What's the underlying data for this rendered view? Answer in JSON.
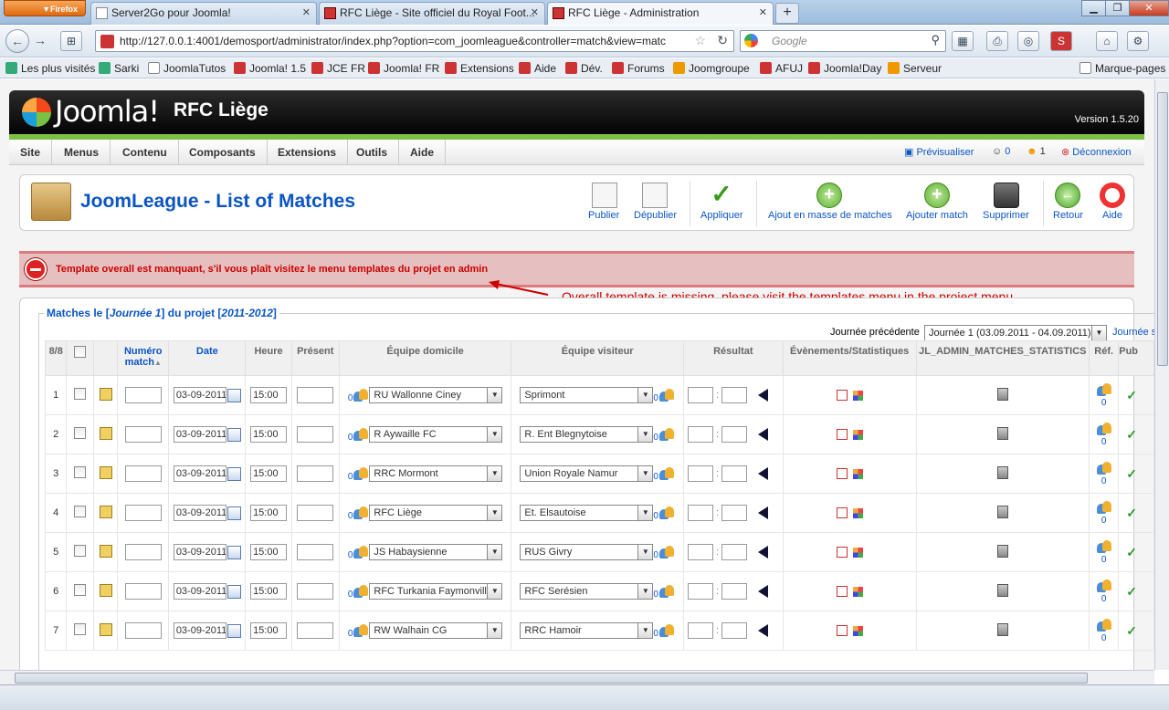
{
  "browser": {
    "app_button": "Firefox",
    "tabs": [
      {
        "title": "Server2Go pour Joomla!"
      },
      {
        "title": "RFC Liège - Site officiel du Royal Foot..."
      },
      {
        "title": "RFC Liège - Administration"
      }
    ],
    "url": "http://127.0.0.1:4001/demosport/administrator/index.php?option=com_joomleague&controller=match&view=matc",
    "search_placeholder": "Google",
    "bookmarks": [
      "Les plus visités",
      "Sarki",
      "JoomlaTutos",
      "Joomla! 1.5",
      "JCE FR",
      "Joomla! FR",
      "Extensions",
      "Aide",
      "Dév.",
      "Forums",
      "Joomgroupe",
      "AFUJ",
      "Joomla!Day",
      "Serveur"
    ],
    "bookmarks_right": "Marque-pages"
  },
  "admin": {
    "logo_text": "Joomla!",
    "site_name": "RFC Liège",
    "version": "Version 1.5.20",
    "menu": [
      "Site",
      "Menus",
      "Contenu",
      "Composants",
      "Extensions",
      "Outils",
      "Aide"
    ],
    "preview": "Prévisualiser",
    "messages_count": "0",
    "users_count": "1",
    "logout": "Déconnexion",
    "page_title": "JoomLeague - List of Matches",
    "toolbar": {
      "publish": "Publier",
      "unpublish": "Dépublier",
      "apply": "Appliquer",
      "mass_add": "Ajout en masse de matches",
      "add": "Ajouter match",
      "delete": "Supprimer",
      "back": "Retour",
      "help": "Aide"
    },
    "alert": "Template overall est manquant, s'il vous plaît visitez le menu templates du projet en admin",
    "annotation": "Overall template is missing, please visit the templates menu in the project menu",
    "legend": {
      "prefix": "Matches le [",
      "round": "Journée 1",
      "mid": "] du projet [",
      "project": "2011-2012",
      "suffix": "]"
    },
    "prev_round_label": "Journée précédente",
    "prev_round_value": "Journée 1 (03.09.2011 - 04.09.2011)",
    "next_round_link": "Journée s",
    "columns": {
      "count": "8/8",
      "match_no": "Numéro match",
      "date": "Date",
      "time": "Heure",
      "present": "Présent",
      "home": "Équipe domicile",
      "away": "Équipe visiteur",
      "result": "Résultat",
      "events": "Évènements/Statistiques",
      "stats": "JL_ADMIN_MATCHES_STATISTICS",
      "ref": "Réf.",
      "pub": "Pub"
    },
    "rows": [
      {
        "num": "1",
        "date": "03-09-2011",
        "time": "15:00",
        "home": "RU Wallonne Ciney",
        "away": "Sprimont",
        "home_count": "0",
        "away_count": "0",
        "ref_count": "0"
      },
      {
        "num": "2",
        "date": "03-09-2011",
        "time": "15:00",
        "home": "R Aywaille FC",
        "away": "R. Ent Blegnytoise",
        "home_count": "0",
        "away_count": "0",
        "ref_count": "0"
      },
      {
        "num": "3",
        "date": "03-09-2011",
        "time": "15:00",
        "home": "RRC Mormont",
        "away": "Union Royale Namur",
        "home_count": "0",
        "away_count": "0",
        "ref_count": "0"
      },
      {
        "num": "4",
        "date": "03-09-2011",
        "time": "15:00",
        "home": "RFC Liège",
        "away": "Et. Elsautoise",
        "home_count": "0",
        "away_count": "0",
        "ref_count": "0"
      },
      {
        "num": "5",
        "date": "03-09-2011",
        "time": "15:00",
        "home": "JS Habaysienne",
        "away": "RUS Givry",
        "home_count": "0",
        "away_count": "0",
        "ref_count": "0"
      },
      {
        "num": "6",
        "date": "03-09-2011",
        "time": "15:00",
        "home": "RFC Turkania Faymonville",
        "away": "RFC Serésien",
        "home_count": "0",
        "away_count": "0",
        "ref_count": "0"
      },
      {
        "num": "7",
        "date": "03-09-2011",
        "time": "15:00",
        "home": "RW Walhain CG",
        "away": "RRC Hamoir",
        "home_count": "0",
        "away_count": "0",
        "ref_count": "0"
      }
    ]
  }
}
